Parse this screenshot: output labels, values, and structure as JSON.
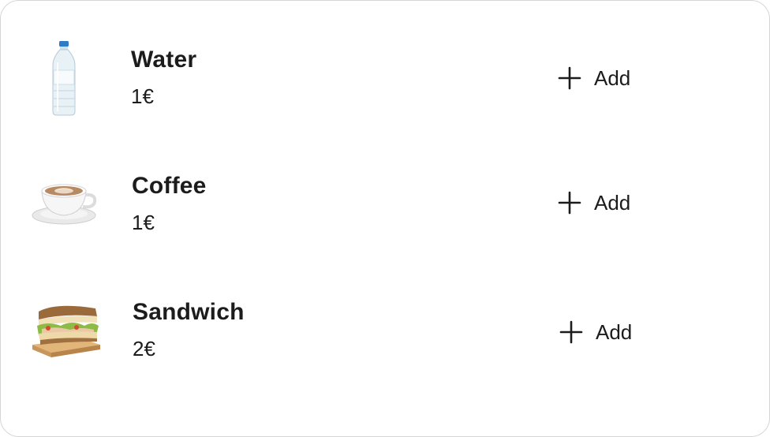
{
  "products": [
    {
      "name": "Water",
      "price": "1€",
      "image": "water-bottle-image",
      "add_label": "Add",
      "add_icon": "plus-icon"
    },
    {
      "name": "Coffee",
      "price": "1€",
      "image": "coffee-cup-image",
      "add_label": "Add",
      "add_icon": "plus-icon"
    },
    {
      "name": "Sandwich",
      "price": "2€",
      "image": "sandwich-image",
      "add_label": "Add",
      "add_icon": "plus-icon"
    }
  ],
  "colors": {
    "border": "#d6d6d6",
    "text": "#1c1c1c",
    "background": "#ffffff"
  }
}
